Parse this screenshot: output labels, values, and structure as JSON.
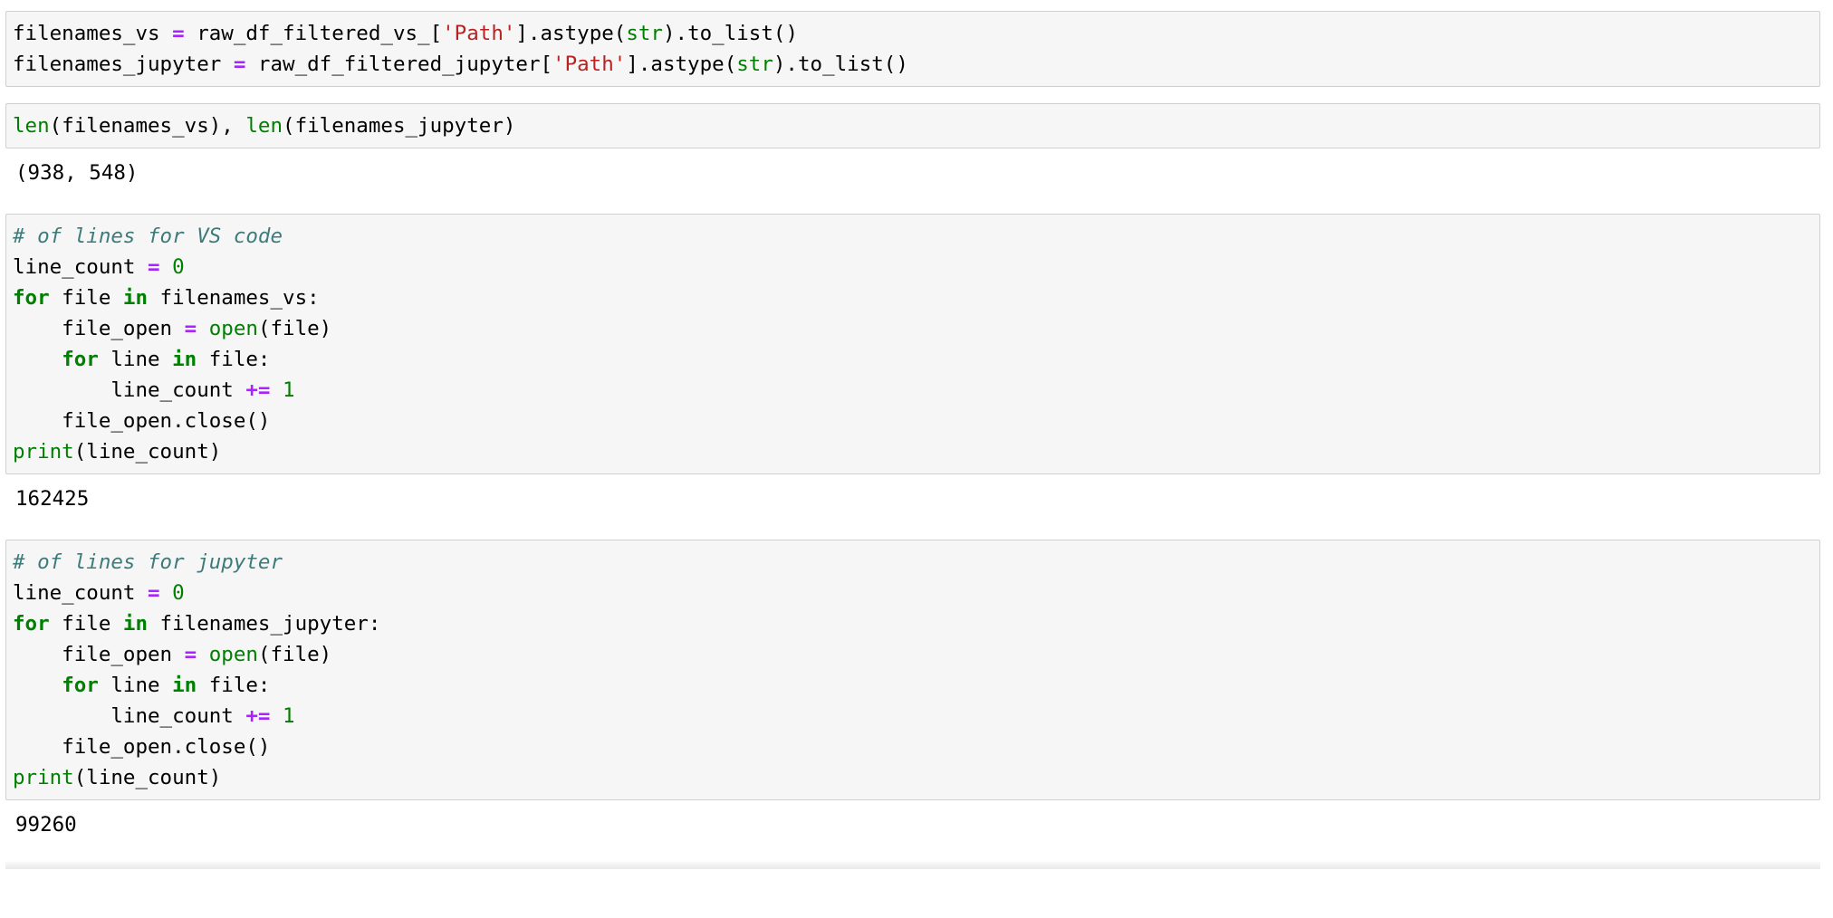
{
  "document": {
    "kind": "jupyter-notebook",
    "theme": {
      "page_background": "#ffffff",
      "cell_background": "#f6f6f6",
      "cell_border": "#cfcfcf",
      "text": "#000000",
      "keyword": "#008000",
      "builtin": "#008000",
      "operator": "#aa22ff",
      "string": "#ba2121",
      "number": "#008000",
      "comment": "#3d7b7b"
    }
  },
  "cells": [
    {
      "id": "cell-1",
      "type": "code",
      "source_lines": [
        [
          {
            "t": "filenames_vs ",
            "c": "tok-n"
          },
          {
            "t": "=",
            "c": "tok-o"
          },
          {
            "t": " raw_df_filtered_vs_[",
            "c": "tok-n"
          },
          {
            "t": "'Path'",
            "c": "tok-s"
          },
          {
            "t": "].astype(",
            "c": "tok-p"
          },
          {
            "t": "str",
            "c": "tok-nb"
          },
          {
            "t": ").to_list()",
            "c": "tok-p"
          }
        ],
        [
          {
            "t": "filenames_jupyter ",
            "c": "tok-n"
          },
          {
            "t": "=",
            "c": "tok-o"
          },
          {
            "t": " raw_df_filtered_jupyter[",
            "c": "tok-n"
          },
          {
            "t": "'Path'",
            "c": "tok-s"
          },
          {
            "t": "].astype(",
            "c": "tok-p"
          },
          {
            "t": "str",
            "c": "tok-nb"
          },
          {
            "t": ").to_list()",
            "c": "tok-p"
          }
        ]
      ],
      "source_text": "filenames_vs = raw_df_filtered_vs_['Path'].astype(str).to_list()\nfilenames_jupyter = raw_df_filtered_jupyter['Path'].astype(str).to_list()",
      "output": null
    },
    {
      "id": "cell-2",
      "type": "code",
      "source_lines": [
        [
          {
            "t": "len",
            "c": "tok-nb"
          },
          {
            "t": "(filenames_vs), ",
            "c": "tok-p"
          },
          {
            "t": "len",
            "c": "tok-nb"
          },
          {
            "t": "(filenames_jupyter)",
            "c": "tok-p"
          }
        ]
      ],
      "source_text": "len(filenames_vs), len(filenames_jupyter)",
      "output": "(938, 548)"
    },
    {
      "id": "cell-3",
      "type": "code",
      "source_lines": [
        [
          {
            "t": "# of lines for VS code",
            "c": "tok-c"
          }
        ],
        [
          {
            "t": "line_count ",
            "c": "tok-n"
          },
          {
            "t": "=",
            "c": "tok-o"
          },
          {
            "t": " ",
            "c": "tok-n"
          },
          {
            "t": "0",
            "c": "tok-m"
          }
        ],
        [
          {
            "t": "for",
            "c": "tok-k"
          },
          {
            "t": " file ",
            "c": "tok-n"
          },
          {
            "t": "in",
            "c": "tok-k"
          },
          {
            "t": " filenames_vs:",
            "c": "tok-n"
          }
        ],
        [
          {
            "t": "    file_open ",
            "c": "tok-n"
          },
          {
            "t": "=",
            "c": "tok-o"
          },
          {
            "t": " ",
            "c": "tok-n"
          },
          {
            "t": "open",
            "c": "tok-nb"
          },
          {
            "t": "(file)",
            "c": "tok-p"
          }
        ],
        [
          {
            "t": "    ",
            "c": "tok-n"
          },
          {
            "t": "for",
            "c": "tok-k"
          },
          {
            "t": " line ",
            "c": "tok-n"
          },
          {
            "t": "in",
            "c": "tok-k"
          },
          {
            "t": " file:",
            "c": "tok-n"
          }
        ],
        [
          {
            "t": "        line_count ",
            "c": "tok-n"
          },
          {
            "t": "+=",
            "c": "tok-o"
          },
          {
            "t": " ",
            "c": "tok-n"
          },
          {
            "t": "1",
            "c": "tok-m"
          }
        ],
        [
          {
            "t": "    file_open.close()",
            "c": "tok-n"
          }
        ],
        [
          {
            "t": "print",
            "c": "tok-nb"
          },
          {
            "t": "(line_count)",
            "c": "tok-p"
          }
        ]
      ],
      "source_text": "# of lines for VS code\nline_count = 0\nfor file in filenames_vs:\n    file_open = open(file)\n    for line in file:\n        line_count += 1\n    file_open.close()\nprint(line_count)",
      "output": "162425"
    },
    {
      "id": "cell-4",
      "type": "code",
      "source_lines": [
        [
          {
            "t": "# of lines for jupyter",
            "c": "tok-c"
          }
        ],
        [
          {
            "t": "line_count ",
            "c": "tok-n"
          },
          {
            "t": "=",
            "c": "tok-o"
          },
          {
            "t": " ",
            "c": "tok-n"
          },
          {
            "t": "0",
            "c": "tok-m"
          }
        ],
        [
          {
            "t": "for",
            "c": "tok-k"
          },
          {
            "t": " file ",
            "c": "tok-n"
          },
          {
            "t": "in",
            "c": "tok-k"
          },
          {
            "t": " filenames_jupyter:",
            "c": "tok-n"
          }
        ],
        [
          {
            "t": "    file_open ",
            "c": "tok-n"
          },
          {
            "t": "=",
            "c": "tok-o"
          },
          {
            "t": " ",
            "c": "tok-n"
          },
          {
            "t": "open",
            "c": "tok-nb"
          },
          {
            "t": "(file)",
            "c": "tok-p"
          }
        ],
        [
          {
            "t": "    ",
            "c": "tok-n"
          },
          {
            "t": "for",
            "c": "tok-k"
          },
          {
            "t": " line ",
            "c": "tok-n"
          },
          {
            "t": "in",
            "c": "tok-k"
          },
          {
            "t": " file:",
            "c": "tok-n"
          }
        ],
        [
          {
            "t": "        line_count ",
            "c": "tok-n"
          },
          {
            "t": "+=",
            "c": "tok-o"
          },
          {
            "t": " ",
            "c": "tok-n"
          },
          {
            "t": "1",
            "c": "tok-m"
          }
        ],
        [
          {
            "t": "    file_open.close()",
            "c": "tok-n"
          }
        ],
        [
          {
            "t": "print",
            "c": "tok-nb"
          },
          {
            "t": "(line_count)",
            "c": "tok-p"
          }
        ]
      ],
      "source_text": "# of lines for jupyter\nline_count = 0\nfor file in filenames_jupyter:\n    file_open = open(file)\n    for line in file:\n        line_count += 1\n    file_open.close()\nprint(line_count)",
      "output": "99260"
    }
  ]
}
